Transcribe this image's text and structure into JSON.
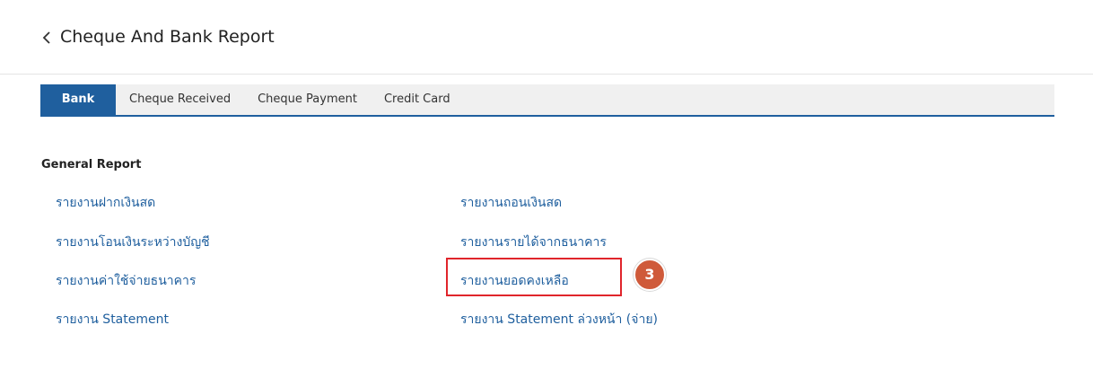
{
  "header": {
    "title": "Cheque And Bank Report",
    "back_icon": "chevron-left-icon"
  },
  "tabs": [
    {
      "label": "Bank",
      "active": true
    },
    {
      "label": "Cheque Received",
      "active": false
    },
    {
      "label": "Cheque Payment",
      "active": false
    },
    {
      "label": "Credit Card",
      "active": false
    }
  ],
  "general_report": {
    "title": "General Report",
    "left_links": [
      "รายงานฝากเงินสด",
      "รายงานโอนเงินระหว่างบัญชี",
      "รายงานค่าใช้จ่ายธนาคาร",
      "รายงาน Statement"
    ],
    "right_links": [
      "รายงานถอนเงินสด",
      "รายงานรายได้จากธนาคาร",
      "รายงานยอดคงเหลือ",
      "รายงาน Statement ล่วงหน้า (จ่าย)"
    ]
  },
  "annotation": {
    "step_number": "3",
    "badge_color": "#cf5a3a",
    "highlight_color": "#e0252b"
  },
  "colors": {
    "accent": "#1f5f9e",
    "link": "#1f5f9e"
  }
}
